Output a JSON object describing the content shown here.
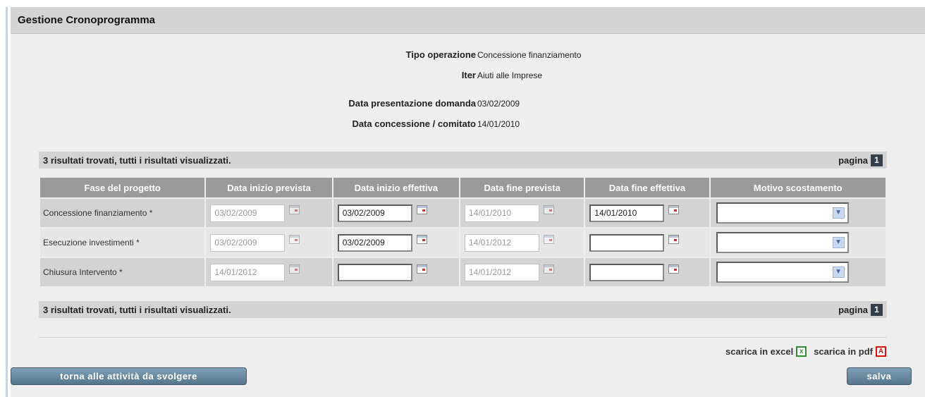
{
  "panel": {
    "title": "Gestione Cronoprogramma"
  },
  "info": {
    "tipo_operazione": {
      "label": "Tipo operazione",
      "value": "Concessione finanziamento"
    },
    "iter": {
      "label": "Iter",
      "value": "Aiuti alle Imprese"
    },
    "data_presentazione": {
      "label": "Data presentazione domanda",
      "value": "03/02/2009"
    },
    "data_concessione": {
      "label": "Data concessione / comitato",
      "value": "14/01/2010"
    }
  },
  "results": {
    "summary": "3 risultati trovati, tutti i risultati visualizzati.",
    "page_label": "pagina",
    "page_number": "1"
  },
  "table": {
    "headers": [
      "Fase del progetto",
      "Data inizio prevista",
      "Data inizio effettiva",
      "Data fine prevista",
      "Data fine effettiva",
      "Motivo scostamento"
    ],
    "rows": [
      {
        "fase": "Concessione finanziamento *",
        "inizio_prevista": "03/02/2009",
        "inizio_effettiva": "03/02/2009",
        "fine_prevista": "14/01/2010",
        "fine_effettiva": "14/01/2010",
        "motivo": ""
      },
      {
        "fase": "Esecuzione investimenti *",
        "inizio_prevista": "03/02/2009",
        "inizio_effettiva": "03/02/2009",
        "fine_prevista": "14/01/2012",
        "fine_effettiva": "",
        "motivo": ""
      },
      {
        "fase": "Chiusura Intervento *",
        "inizio_prevista": "14/01/2012",
        "inizio_effettiva": "",
        "fine_prevista": "14/01/2012",
        "fine_effettiva": "",
        "motivo": ""
      }
    ]
  },
  "downloads": {
    "excel_label": "scarica in excel",
    "pdf_label": "scarica in pdf"
  },
  "buttons": {
    "back_label": "torna alle attività da svolgere",
    "save_label": "salva"
  },
  "icons": {
    "calendar": "calendar-icon",
    "excel": "excel-icon",
    "pdf": "pdf-icon",
    "dropdown": "chevron-down-icon"
  },
  "colors": {
    "header_bg": "#d4d4d4",
    "table_header_bg": "#9a9a9a",
    "button_bg": "#56768c",
    "page_badge_bg": "#333f4b"
  }
}
